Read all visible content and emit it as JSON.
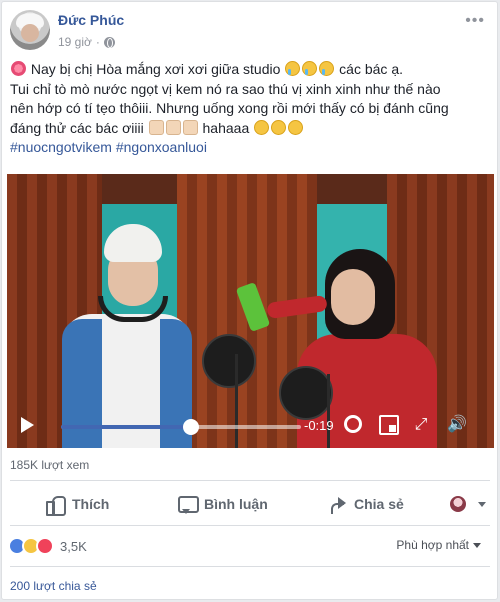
{
  "post": {
    "author": "Đức Phúc",
    "time": "19 giờ",
    "more_icon": "ellipsis-icon",
    "privacy_icon": "globe-icon",
    "lines": [
      " Nay bị chị Hòa mắng xơi xơi giữa studio ",
      " các bác ạ.",
      "Tui chỉ tò mò nước ngọt vị kem nó ra sao thú vị xinh xinh như thế nào",
      "nên hớp có tí tẹo thôiii. Nhưng uống xong rồi mới thấy có bị đánh cũng",
      "đáng thử các bác ơiiii ",
      " hahaaa "
    ],
    "hashtags": "#nuocngotvikem #ngonxoanluoi"
  },
  "video": {
    "time_remaining": "-0:19",
    "progress": 0.54
  },
  "views": "185K lượt xem",
  "actions": {
    "like": "Thích",
    "comment": "Bình luận",
    "share": "Chia sẻ"
  },
  "reactions": {
    "count": "3,5K",
    "sort_label": "Phù hợp nhất"
  },
  "shares": "200 lượt chia sẻ",
  "colors": {
    "link": "#365899",
    "accent": "#4267b2",
    "muted": "#90949c"
  }
}
